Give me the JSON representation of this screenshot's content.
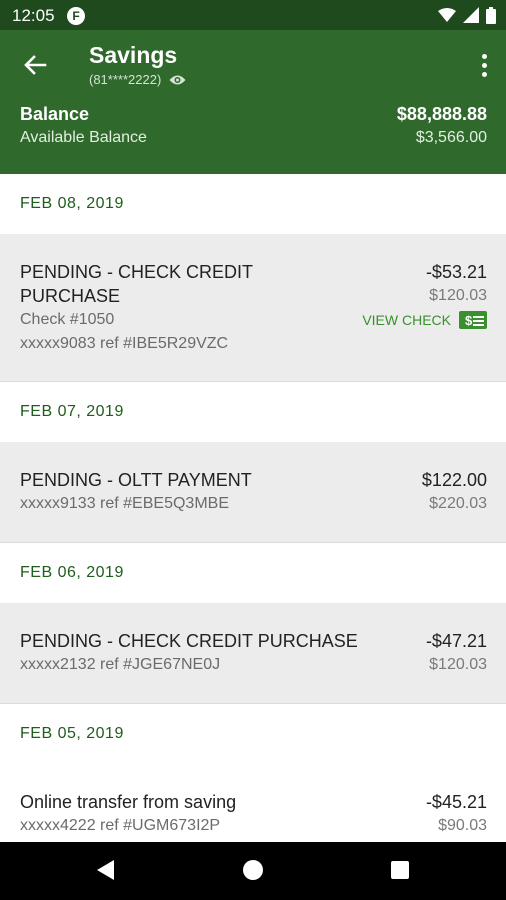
{
  "status_bar": {
    "time": "12:05",
    "app_icon": "F"
  },
  "header": {
    "title": "Savings",
    "account_masked": "(81****2222)",
    "balance_label": "Balance",
    "balance_value": "$88,888.88",
    "available_label": "Available Balance",
    "available_value": "$3,566.00"
  },
  "groups": [
    {
      "date": "FEB 08, 2019",
      "txn": {
        "desc_line1": "PENDING - CHECK CREDIT",
        "desc_line2": "PURCHASE",
        "check": "Check #1050",
        "ref": "xxxxx9083 ref #IBE5R29VZC",
        "amount": "-$53.21",
        "running": "$120.03",
        "view_check": "VIEW CHECK"
      }
    },
    {
      "date": "FEB 07, 2019",
      "txn": {
        "desc": "PENDING - OLTT PAYMENT",
        "ref": "xxxxx9133 ref #EBE5Q3MBE",
        "amount": "$122.00",
        "running": "$220.03"
      }
    },
    {
      "date": "FEB 06, 2019",
      "txn": {
        "desc": "PENDING - CHECK CREDIT PURCHASE",
        "ref": "xxxxx2132 ref #JGE67NE0J",
        "amount": "-$47.21",
        "running": "$120.03"
      }
    },
    {
      "date": "FEB 05, 2019",
      "txn": {
        "desc": "Online transfer from saving",
        "ref": "xxxxx4222 ref #UGM673I2P",
        "amount": "-$45.21",
        "running": "$90.03"
      }
    }
  ],
  "colors": {
    "header_bg": "#2f6a2c",
    "status_bg": "#1f4a1e",
    "accent_green": "#3a8f2e",
    "date_text": "#1f5d1c"
  },
  "icons": [
    "back-arrow-icon",
    "eye-icon",
    "more-vert-icon",
    "check-icon",
    "nav-back-icon",
    "nav-home-icon",
    "nav-recents-icon",
    "wifi-icon",
    "signal-icon",
    "battery-icon"
  ]
}
